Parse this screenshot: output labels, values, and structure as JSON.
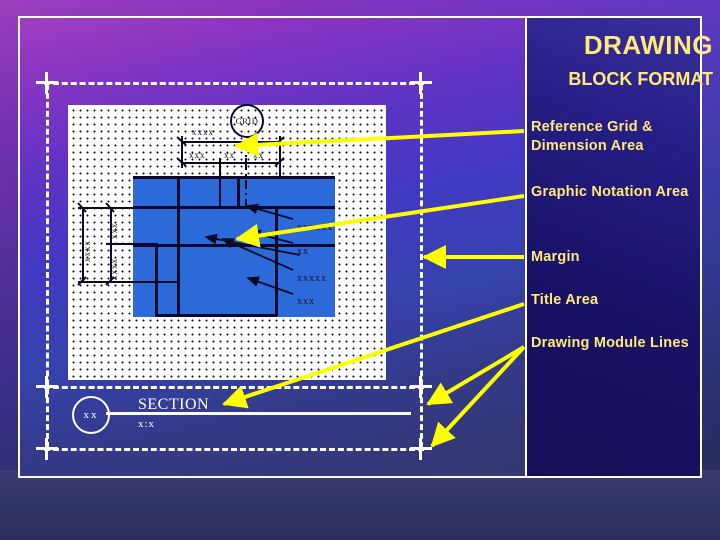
{
  "slide": {
    "title_main": "DRAWING",
    "title_sub": "BLOCK FORMAT"
  },
  "legend": {
    "items": [
      {
        "label": "Reference Grid & Dimension Area"
      },
      {
        "label": "Graphic Notation Area"
      },
      {
        "label": "Margin"
      },
      {
        "label": "Title Area"
      },
      {
        "label": "Drawing Module Lines"
      }
    ]
  },
  "drawing": {
    "grid_bubble": "GRID",
    "horizontal_dimensions": {
      "overall": "xxxx",
      "segments": [
        "xxx",
        "xx",
        "xx"
      ]
    },
    "vertical_dimensions": {
      "overall": "xxxx",
      "segments": [
        "xxx",
        "xxxx"
      ]
    },
    "leader_notes": [
      "xxxxxx",
      "xx",
      "xxxxx",
      "xxx"
    ],
    "title_block": {
      "bubble": "xx",
      "section_label": "SECTION",
      "scale": "x:x"
    }
  },
  "colors": {
    "accent_text": "#ffe97a",
    "arrow": "#ffff00",
    "graphic_area": "#2c6ada",
    "frame": "#ffffff",
    "linework": "#0a0a28"
  }
}
